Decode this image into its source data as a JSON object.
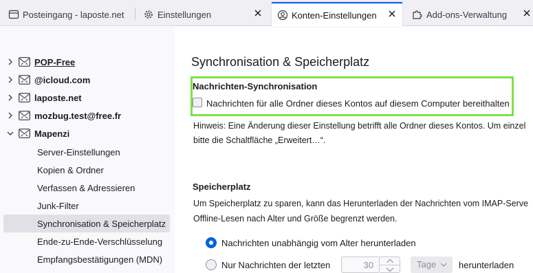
{
  "tabs": [
    {
      "label": "Posteingang - laposte.net",
      "icon": "inbox-icon",
      "active": false
    },
    {
      "label": "Einstellungen",
      "icon": "gear-icon",
      "active": false
    },
    {
      "label": "Konten-Einstellungen",
      "icon": "account-circle-icon",
      "active": true
    },
    {
      "label": "Add-ons-Verwaltung",
      "icon": "puzzle-icon",
      "active": false
    }
  ],
  "sidebar": {
    "accounts": [
      {
        "label": "POP-Free",
        "expanded": false
      },
      {
        "label": "@icloud.com",
        "expanded": false
      },
      {
        "label": "laposte.net",
        "expanded": false
      },
      {
        "label": "mozbug.test@free.fr",
        "expanded": false
      },
      {
        "label": "Mapenzi",
        "expanded": true
      }
    ],
    "subitems": [
      {
        "label": "Server-Einstellungen"
      },
      {
        "label": "Kopien & Ordner"
      },
      {
        "label": "Verfassen & Adressieren"
      },
      {
        "label": "Junk-Filter"
      },
      {
        "label": "Synchronisation & Speicherplatz",
        "selected": true
      },
      {
        "label": "Ende-zu-Ende-Verschlüsselung"
      },
      {
        "label": "Empfangsbestätigungen (MDN)"
      }
    ]
  },
  "main": {
    "title": "Synchronisation & Speicherplatz",
    "sync": {
      "heading": "Nachrichten-Synchronisation",
      "checkbox_label": "Nachrichten für alle Ordner dieses Kontos auf diesem Computer bereithalten",
      "checkbox_checked": false,
      "hint_line1": "Hinweis: Eine Änderung dieser Einstellung betrifft alle Ordner dieses Kontos. Um einzel",
      "hint_line2": "bitte die Schaltfläche „Erweitert…“."
    },
    "storage": {
      "heading": "Speicherplatz",
      "desc_line1": "Um Speicherplatz zu sparen, kann das Herunterladen der Nachrichten vom IMAP-Serve",
      "desc_line2": "Offline-Lesen nach Alter und Größe begrenzt werden.",
      "radio_all": "Nachrichten unabhängig vom Alter herunterladen",
      "radio_recent": "Nur Nachrichten der letzten",
      "age_value": "30",
      "age_unit": "Tage",
      "suffix": "herunterladen"
    }
  },
  "colors": {
    "accent": "#0060df",
    "highlight": "#7fe04a"
  }
}
